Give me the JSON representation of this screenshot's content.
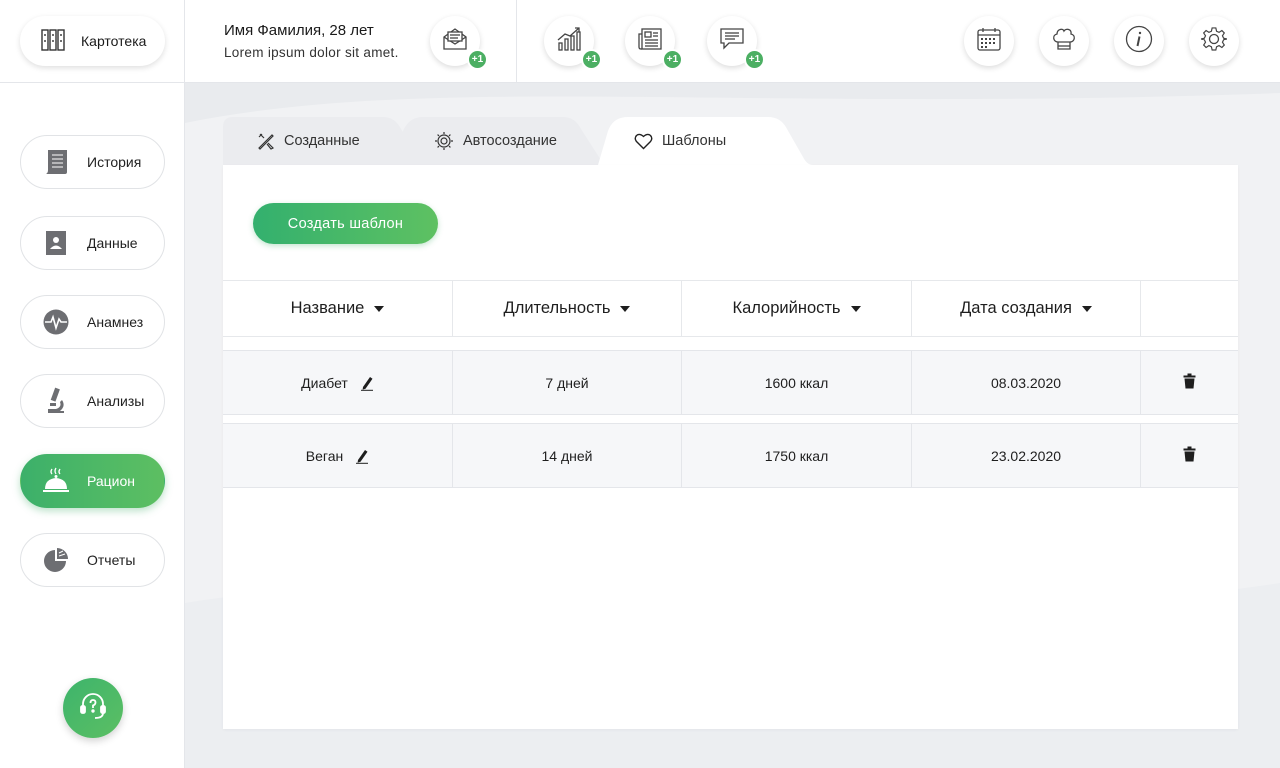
{
  "header": {
    "kartoteka_label": "Картотека",
    "user_name": "Имя Фамилия, 28 лет",
    "user_sub": "Lorem ipsum dolor sit amet.",
    "badges": [
      "+1",
      "+1",
      "+1",
      "+1"
    ]
  },
  "sidebar": {
    "items": [
      {
        "label": "История",
        "icon": "scroll-icon"
      },
      {
        "label": "Данные",
        "icon": "id-card-icon"
      },
      {
        "label": "Анамнез",
        "icon": "heartbeat-icon"
      },
      {
        "label": "Анализы",
        "icon": "microscope-icon"
      },
      {
        "label": "Рацион",
        "icon": "cloche-icon",
        "active": true
      },
      {
        "label": "Отчеты",
        "icon": "pie-chart-icon"
      }
    ]
  },
  "tabs": [
    {
      "label": "Созданные",
      "icon": "tools-icon"
    },
    {
      "label": "Автосоздание",
      "icon": "gear-cycle-icon"
    },
    {
      "label": "Шаблоны",
      "icon": "heart-icon",
      "active": true
    }
  ],
  "main": {
    "create_button": "Создать шаблон",
    "columns": [
      "Название",
      "Длительность",
      "Калорийность",
      "Дата создания"
    ],
    "rows": [
      {
        "name": "Диабет",
        "duration": "7 дней",
        "calories": "1600 ккал",
        "date": "08.03.2020"
      },
      {
        "name": "Веган",
        "duration": "14 дней",
        "calories": "1750 ккал",
        "date": "23.02.2020"
      }
    ]
  },
  "colors": {
    "accent": "#4caf63",
    "accent_dark": "#33b06e"
  }
}
